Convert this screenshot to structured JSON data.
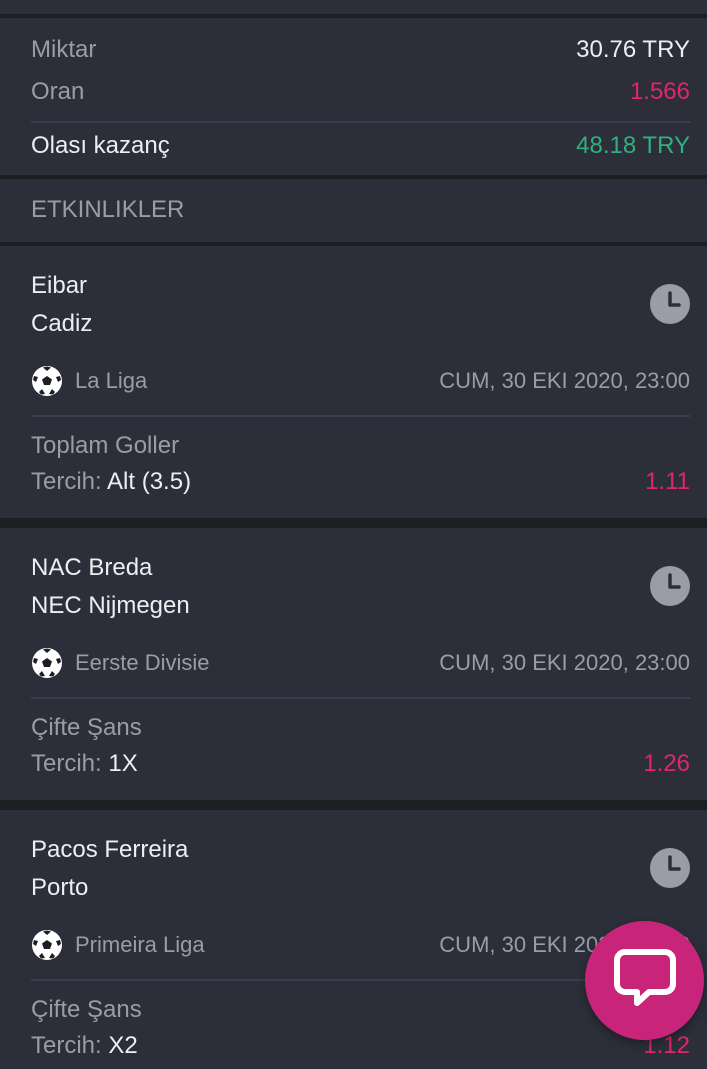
{
  "summary": {
    "amount_label": "Miktar",
    "amount_value": "30.76 TRY",
    "odds_label": "Oran",
    "odds_value": "1.566",
    "win_label": "Olası kazanç",
    "win_value": "48.18 TRY"
  },
  "events_header": "ETKINLIKLER",
  "choice_label": "Tercih:",
  "events": [
    {
      "home": "Eibar",
      "away": "Cadiz",
      "league": "La Liga",
      "datetime": "CUM, 30 EKI 2020, 23:00",
      "market": "Toplam Goller",
      "choice": "Alt (3.5)",
      "odds": "1.11"
    },
    {
      "home": "NAC Breda",
      "away": "NEC Nijmegen",
      "league": "Eerste Divisie",
      "datetime": "CUM, 30 EKI 2020, 23:00",
      "market": "Çifte Şans",
      "choice": "1X",
      "odds": "1.26"
    },
    {
      "home": "Pacos Ferreira",
      "away": "Porto",
      "league": "Primeira Liga",
      "datetime": "CUM, 30 EKI 2020, 23:00",
      "market": "Çifte Şans",
      "choice": "X2",
      "odds": "1.12"
    }
  ],
  "icons": {
    "clock": "clock-icon",
    "ball": "soccer-ball-icon",
    "chat": "chat-bubble-icon"
  },
  "colors": {
    "background": "#1c1e24",
    "panel": "#2c2f3a",
    "accent_pink": "#e0266b",
    "accent_green": "#2fb07c",
    "chat_button": "#c8257a"
  }
}
